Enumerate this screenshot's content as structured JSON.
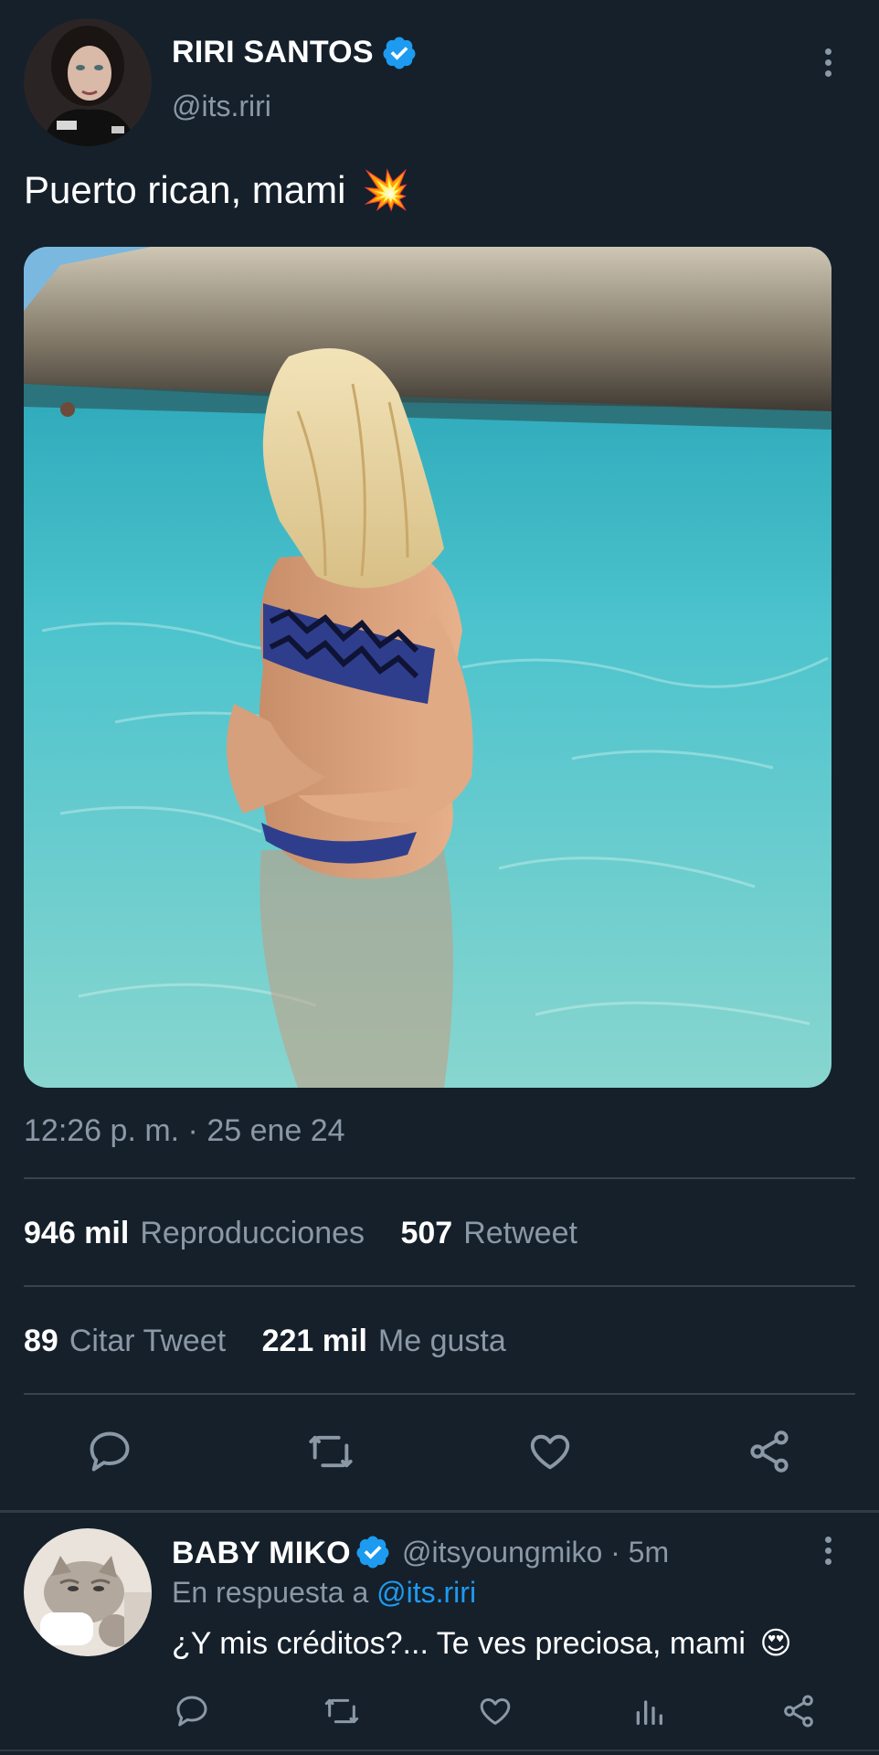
{
  "main_tweet": {
    "author_name": "RIRI SANTOS",
    "author_handle": "@its.riri",
    "text": "Puerto rican, mami",
    "emoji": "💥",
    "timestamp": "12:26 p. m. · 25 ene 24",
    "stats": {
      "views_count": "946 mil",
      "views_label": "Reproducciones",
      "retweets_count": "507",
      "retweets_label": "Retweet",
      "quotes_count": "89",
      "quotes_label": "Citar Tweet",
      "likes_count": "221 mil",
      "likes_label": "Me gusta"
    },
    "icons": [
      "reply-icon",
      "retweet-icon",
      "like-icon",
      "share-icon",
      "more-icon",
      "verified-icon"
    ]
  },
  "reply": {
    "author_name": "BABY MIKO",
    "author_handle": "@itsyoungmiko",
    "time": "· 5m",
    "replying_prefix": "En respuesta a",
    "replying_to": "@its.riri",
    "text": "¿Y mis créditos?... Te ves preciosa, mami",
    "emoji": "😍",
    "icons": [
      "reply-icon",
      "retweet-icon",
      "like-icon",
      "views-icon",
      "share-icon"
    ]
  },
  "colors": {
    "background": "#15202b",
    "text": "#ffffff",
    "muted": "#8b98a5",
    "accent": "#1d9bf0",
    "divider": "#38444d"
  }
}
